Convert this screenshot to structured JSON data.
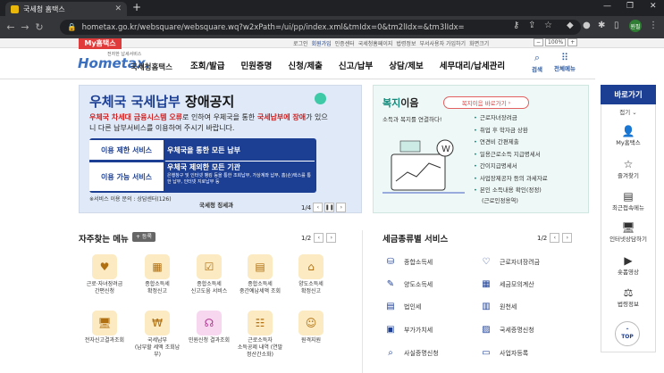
{
  "browser": {
    "tab_title": "국세청 홈택스",
    "url": "hometax.go.kr/websquare/websquare.wq?w2xPath=/ui/pp/index.xml&tmIdx=0&tm2lIdx=&tm3lIdx=",
    "profile": "원필"
  },
  "topbar": {
    "my_label": "My홈택스",
    "links": [
      "로그인",
      "회원가입",
      "인증센터",
      "국세청홈페이지",
      "법령정보",
      "부서사용자 가입하기",
      "화면크기"
    ],
    "zoom": "100%"
  },
  "header": {
    "logo_main": "Hometax.",
    "logo_sub": "국세청홈택스",
    "logo_tag": "전자한 납세서비스",
    "menu": [
      "조회/발급",
      "민원증명",
      "신청/제출",
      "신고/납부",
      "상담/제보",
      "세무대리/납세관리"
    ],
    "search_label": "검색",
    "all_menu_label": "전체메뉴"
  },
  "banner": {
    "title_blue": "우체국 국세납부",
    "title_rest": " 장애공지",
    "desc_red1": "우체국 차세대 금융시스템 오류",
    "desc_1": "로 인하여 우체국을 통한 ",
    "desc_red2": "국세납부에 장애",
    "desc_2": "가 있으니 다른 납부서비스를 이용하여 주시기 바랍니다.",
    "row1_key": "이용 제한 서비스",
    "row1_val": "우체국을 통한 모든 납부",
    "row2_key": "이용 가능 서비스",
    "row2_val": "우체국 제외한 모든 기관",
    "row2_sub": "은행창구 및 인터넷 뱅킹 등을 통한 조회납부, 가상계좌 납부, 홈(손)택스를 통한 납부, 인터넷 지로납부 등",
    "note": "※서비스 이용 문의 : 상담센터(126)",
    "sign": "국세청 징세과",
    "pager": "1/4"
  },
  "welfare": {
    "title_green": "복지",
    "title_rest": "이음",
    "button": "복지이음 바로가기",
    "desc": "소득과 복지를 연결하다!",
    "list": [
      "근로자녀장려금",
      "취업 후 학자금 상환",
      "연견비 간편제출",
      "일용근로소득 지급명세서",
      "간이지급명세서",
      "사업장제공자 등의 과세자료",
      "본인 소득내용 확인(정정)",
      "(근로인정용역)"
    ]
  },
  "quick": {
    "title": "바로가기",
    "fold": "접기",
    "items": [
      "My홈택스",
      "즐겨찾기",
      "최근접속메뉴",
      "인터넷상담하기",
      "숏폼영상",
      "법령정보"
    ],
    "top": "TOP"
  },
  "favorites": {
    "title": "자주찾는 메뉴",
    "add": "+ 등록",
    "pager": "1/2",
    "items": [
      {
        "l1": "근로·자녀장려금",
        "l2": "간편신청"
      },
      {
        "l1": "종합소득세",
        "l2": "확정신고"
      },
      {
        "l1": "종합소득세",
        "l2": "신고도움 서비스"
      },
      {
        "l1": "종합소득세",
        "l2": "중간예납세액 조회"
      },
      {
        "l1": "양도소득세",
        "l2": "확정신고"
      },
      {
        "l1": "전자신고결과조회",
        "l2": ""
      },
      {
        "l1": "국세납부",
        "l2": "(납부할 세액 조회납부)"
      },
      {
        "l1": "민원신청 결과조회",
        "l2": ""
      },
      {
        "l1": "근로소득자",
        "l2": "소득공제 내역 (연말정산간소화)"
      },
      {
        "l1": "원격지원",
        "l2": ""
      }
    ]
  },
  "tax": {
    "title": "세금종류별 서비스",
    "pager": "1/2",
    "items": [
      "종합소득세",
      "근로자녀장려금",
      "양도소득세",
      "세금모의계산",
      "법인세",
      "원천세",
      "부가가치세",
      "국세증명신청",
      "사실증명신청",
      "사업자등록"
    ]
  }
}
